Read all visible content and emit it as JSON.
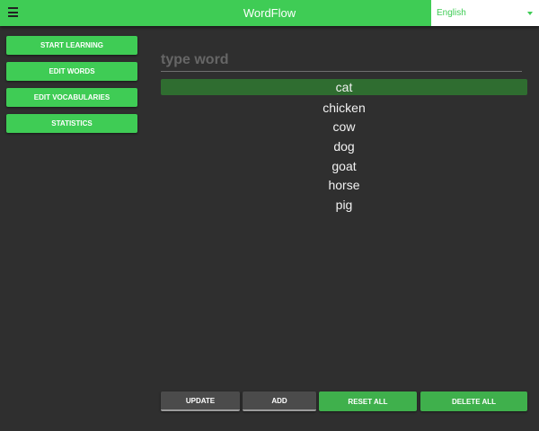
{
  "header": {
    "title": "WordFlow",
    "language": "English"
  },
  "sidebar": {
    "items": [
      {
        "label": "START LEARNING"
      },
      {
        "label": "EDIT WORDS"
      },
      {
        "label": "EDIT VOCABULARIES"
      },
      {
        "label": "STATISTICS"
      }
    ]
  },
  "search": {
    "placeholder": "type word",
    "value": ""
  },
  "words": {
    "selected": "cat",
    "items": [
      "cat",
      "chicken",
      "cow",
      "dog",
      "goat",
      "horse",
      "pig"
    ]
  },
  "actions": {
    "update": "UPDATE",
    "add": "ADD",
    "reset_all": "RESET ALL",
    "delete_all": "DELETE ALL"
  },
  "colors": {
    "accent": "#3fcc55",
    "background": "#2f2f2f",
    "selected_row": "#2f6d30"
  }
}
